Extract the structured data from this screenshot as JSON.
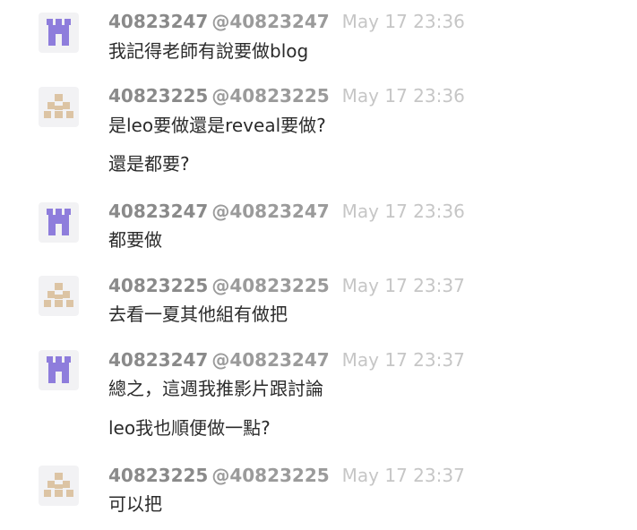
{
  "messages": [
    {
      "username": "40823247",
      "handle": "@40823247",
      "time": "May 17 23:36",
      "avatar": "purple-castle-identicon",
      "avatar_color": "#8e7ddc",
      "lines": [
        "我記得老師有說要做blog"
      ]
    },
    {
      "username": "40823225",
      "handle": "@40823225",
      "time": "May 17 23:36",
      "avatar": "tan-diamond-identicon",
      "avatar_color": "#dcc4a4",
      "lines": [
        "是leo要做還是reveal要做?",
        "還是都要?"
      ]
    },
    {
      "username": "40823247",
      "handle": "@40823247",
      "time": "May 17 23:36",
      "avatar": "purple-castle-identicon",
      "avatar_color": "#8e7ddc",
      "lines": [
        "都要做"
      ]
    },
    {
      "username": "40823225",
      "handle": "@40823225",
      "time": "May 17 23:37",
      "avatar": "tan-diamond-identicon",
      "avatar_color": "#dcc4a4",
      "lines": [
        "去看一夏其他組有做把"
      ]
    },
    {
      "username": "40823247",
      "handle": "@40823247",
      "time": "May 17 23:37",
      "avatar": "purple-castle-identicon",
      "avatar_color": "#8e7ddc",
      "lines": [
        "總之，這週我推影片跟討論",
        "leo我也順便做一點?"
      ]
    },
    {
      "username": "40823225",
      "handle": "@40823225",
      "time": "May 17 23:37",
      "avatar": "tan-diamond-identicon",
      "avatar_color": "#dcc4a4",
      "lines": [
        "可以把"
      ]
    }
  ]
}
